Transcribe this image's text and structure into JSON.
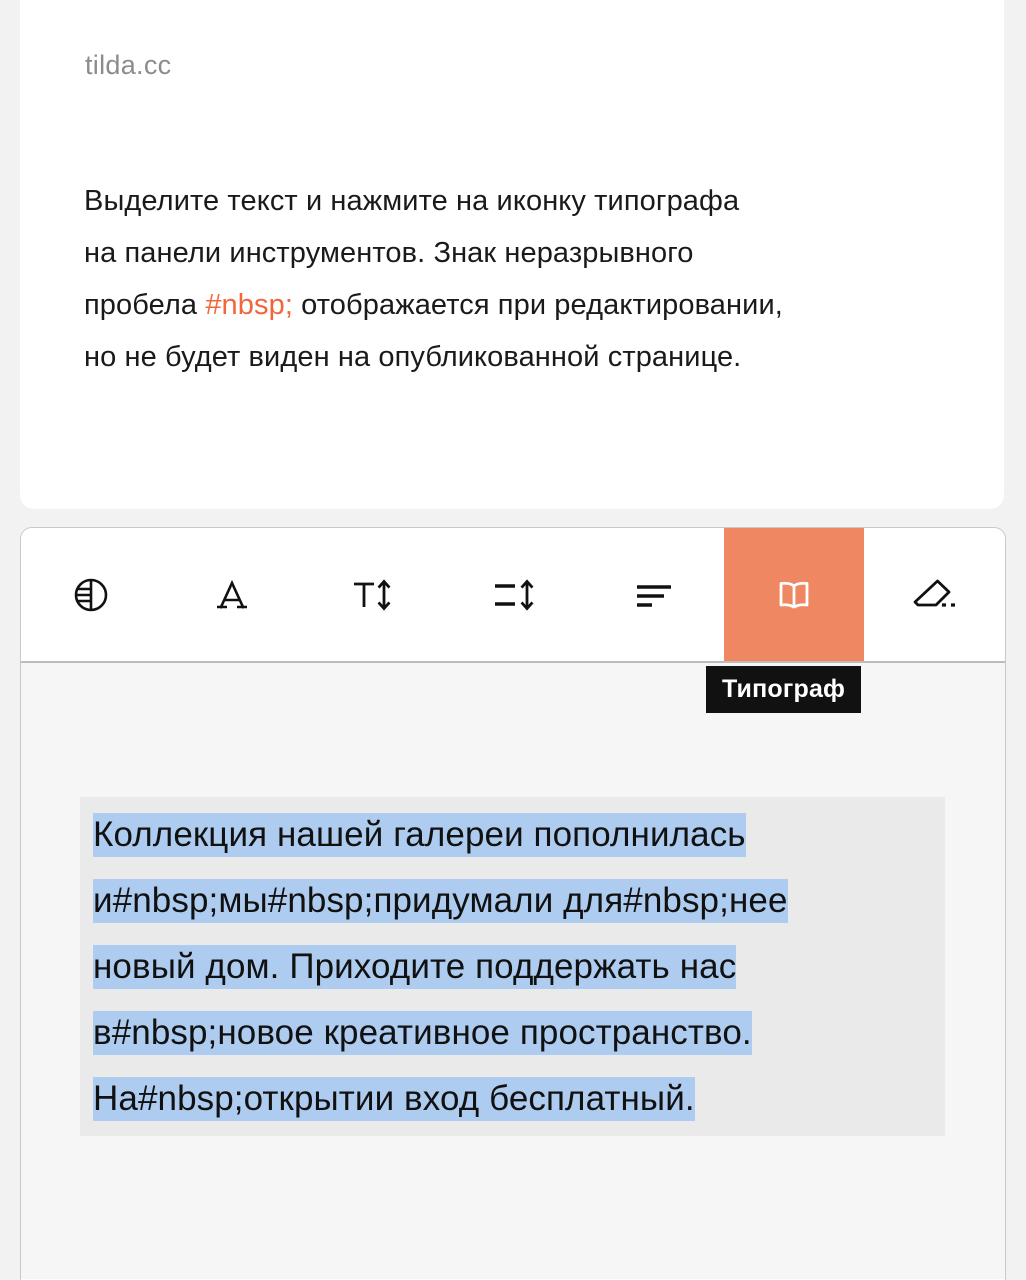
{
  "page": {
    "site_label": "tilda.cc",
    "background_color": "#F2F2F2"
  },
  "info_card": {
    "paragraph_lines": [
      "Выделите текст и нажмите на иконку типографа",
      "на панели инструментов. Знак неразрывного",
      "пробела #nbsp; отображается при редактировании,",
      "но не будет виден на опубликованной странице."
    ],
    "paragraph_before_token": "пробела ",
    "highlight_token": "#nbsp;",
    "paragraph_after_token": " отображается при редактировании,",
    "line1": "Выделите текст и нажмите на иконку типографа",
    "line2": "на панели инструментов. Знак неразрывного",
    "line4": "но не будет виден на опубликованной странице.",
    "token_color": "#F2663C"
  },
  "toolbar": {
    "active_color": "#EE8762",
    "buttons": [
      {
        "name": "color-contrast-icon",
        "label": "Цвет"
      },
      {
        "name": "font-family-icon",
        "label": "Шрифт"
      },
      {
        "name": "font-size-icon",
        "label": "Размер"
      },
      {
        "name": "line-height-icon",
        "label": "Межстрочный интервал"
      },
      {
        "name": "align-left-icon",
        "label": "Выравнивание"
      },
      {
        "name": "typograf-book-icon",
        "label": "Типограф"
      },
      {
        "name": "clear-format-eraser-icon",
        "label": "Очистить форматирование"
      }
    ],
    "active_index": 5,
    "tooltip": "Типограф"
  },
  "editor": {
    "selection_color": "#AECCEF",
    "block_background": "#EAEAEA",
    "lines": [
      {
        "text": "Коллекция нашей галереи пополнилась",
        "selected": true
      },
      {
        "text": "и#nbsp;мы#nbsp;придумали для#nbsp;нее",
        "selected": true
      },
      {
        "text": "новый дом. Приходите поддержать нас",
        "selected": true
      },
      {
        "text": "в#nbsp;новое креативное пространство.",
        "selected": true
      },
      {
        "text": "На#nbsp;открытии вход бесплатный.",
        "selected": true
      }
    ],
    "full_text": "Коллекция нашей галереи пополнилась и#nbsp;мы#nbsp;придумали для#nbsp;нее новый дом. Приходите поддержать нас в#nbsp;новое креативное пространство. На#nbsp;открытии вход бесплатный."
  }
}
